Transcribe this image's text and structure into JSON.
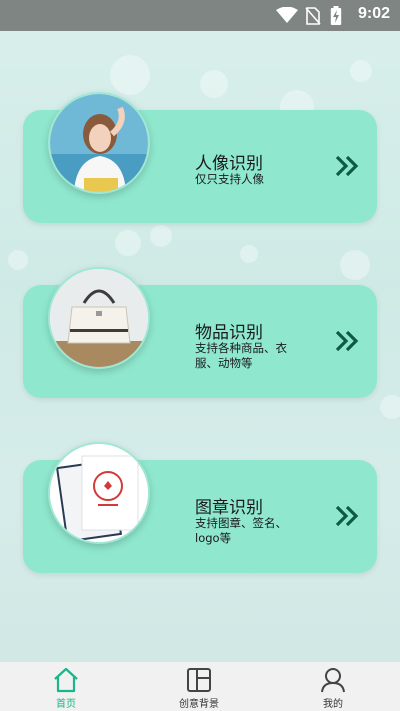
{
  "status_bar": {
    "time": "9:02"
  },
  "cards": [
    {
      "title": "人像识别",
      "subtitle": "仅只支持人像",
      "photo": "woman-portrait"
    },
    {
      "title": "物品识别",
      "subtitle": "支持各种商品、衣服、动物等",
      "photo": "handbag"
    },
    {
      "title": "图章识别",
      "subtitle": "支持图章、签名、logo等",
      "photo": "stamped-document"
    }
  ],
  "tabs": [
    {
      "label": "首页",
      "icon": "home-icon",
      "active": true
    },
    {
      "label": "创意背景",
      "icon": "layout-icon",
      "active": false
    },
    {
      "label": "我的",
      "icon": "user-icon",
      "active": false
    }
  ],
  "colors": {
    "card": "#8fe8ce",
    "accent": "#19b58c",
    "chevron": "#0e5a46"
  }
}
